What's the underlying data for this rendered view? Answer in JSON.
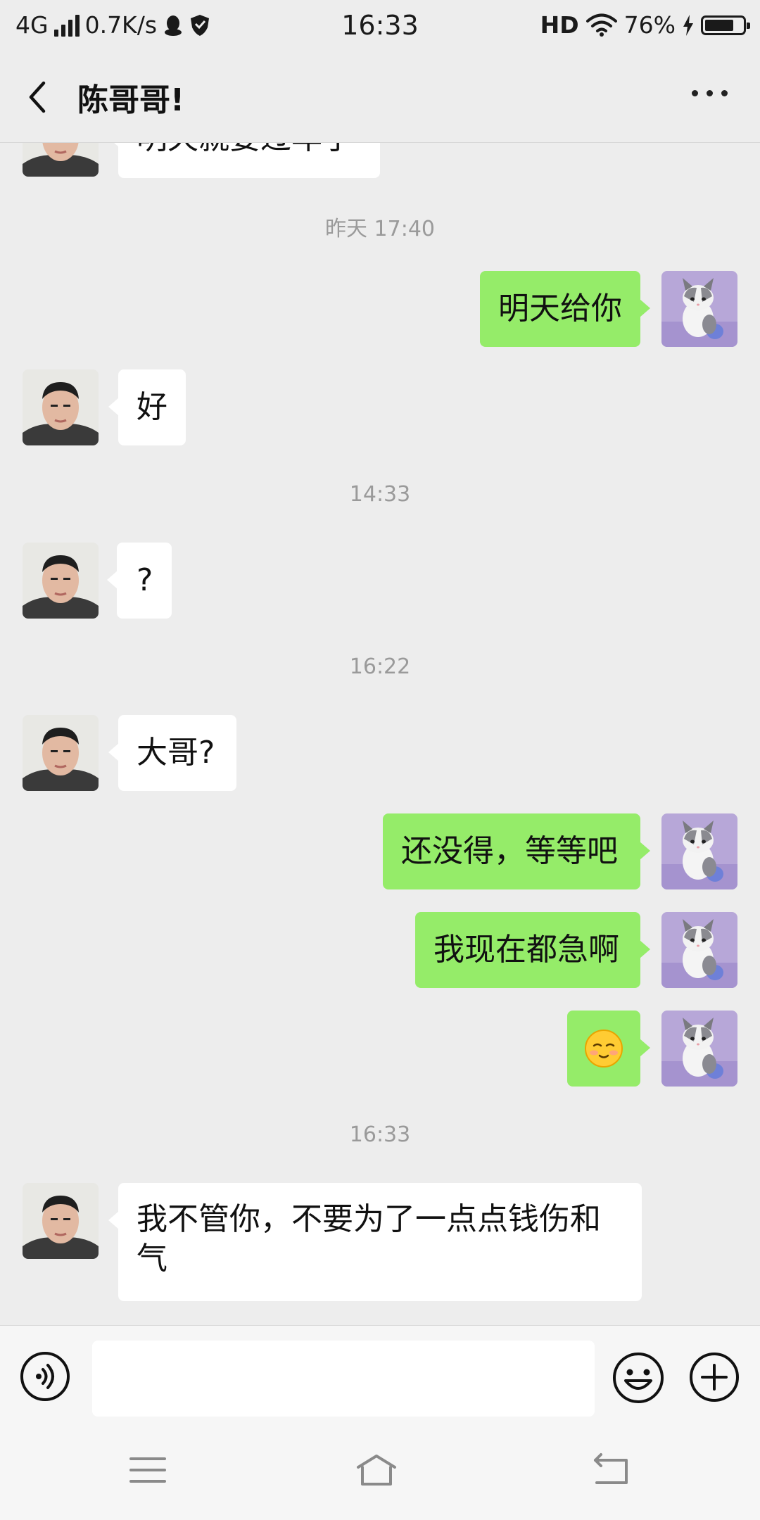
{
  "status_bar": {
    "network": "4G",
    "speed": "0.7K/s",
    "time": "16:33",
    "hd": "HD",
    "battery": "76%",
    "battery_level": 0.76,
    "icons": [
      "signal-icon",
      "qq-icon",
      "shield-icon",
      "wifi-icon",
      "charging-icon",
      "battery-icon"
    ]
  },
  "header": {
    "title": "陈哥哥!",
    "back_icon": "chevron-left-icon",
    "more_icon": "more-dots-icon"
  },
  "messages": [
    {
      "type": "in",
      "text": "明天就要过年了"
    },
    {
      "type": "timestamp",
      "text": "昨天 17:40"
    },
    {
      "type": "out",
      "text": "明天给你"
    },
    {
      "type": "in",
      "text": "好"
    },
    {
      "type": "timestamp",
      "text": "14:33"
    },
    {
      "type": "in",
      "text": "?"
    },
    {
      "type": "timestamp",
      "text": "16:22"
    },
    {
      "type": "in",
      "text": "大哥?"
    },
    {
      "type": "out",
      "text": "还没得，等等吧"
    },
    {
      "type": "out",
      "text": "我现在都急啊"
    },
    {
      "type": "out",
      "text": "",
      "emoji": "smiling-face-emoji"
    },
    {
      "type": "timestamp",
      "text": "16:33"
    },
    {
      "type": "in",
      "text": "我不管你，不要为了一点点钱伤和气"
    }
  ],
  "input_bar": {
    "value": "",
    "icons": [
      "voice-icon",
      "emoji-icon",
      "plus-icon"
    ]
  },
  "nav_bar": {
    "icons": [
      "menu-icon",
      "home-icon",
      "back-nav-icon"
    ]
  },
  "colors": {
    "background": "#ededed",
    "outgoing_bubble": "#95ec69",
    "incoming_bubble": "#ffffff",
    "timestamp": "#9a9a9a"
  }
}
